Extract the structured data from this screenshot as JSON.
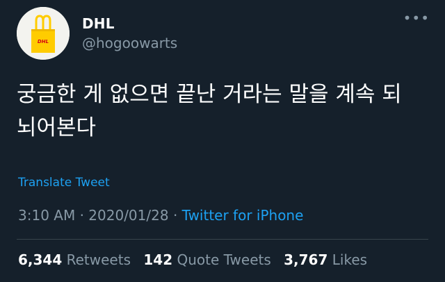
{
  "user": {
    "display_name": "DHL",
    "handle": "@hogoowarts",
    "avatar_icon": "yellow-dhl-tote-bag",
    "avatar_logo_text": "DHL"
  },
  "tweet": {
    "text_line1": "궁금한 게 없으면 끝난 거라는 말을 계속 되",
    "text_line2": "뇌어본다",
    "translate_label": "Translate Tweet",
    "time": "3:10 AM",
    "date": "2020/01/28",
    "separator": "·",
    "source": "Twitter for iPhone"
  },
  "stats": {
    "retweets_count": "6,344",
    "retweets_label": "Retweets",
    "quote_count": "142",
    "quote_label": "Quote Tweets",
    "likes_count": "3,767",
    "likes_label": "Likes"
  },
  "menu": {
    "more_icon": "more-horizontal-icon",
    "more_glyph": "•••"
  },
  "colors": {
    "background": "#15202b",
    "text": "#ffffff",
    "secondary_text": "#8899a6",
    "link": "#1da1f2",
    "divider": "#38444d",
    "avatar_bag": "#ffcc00"
  }
}
